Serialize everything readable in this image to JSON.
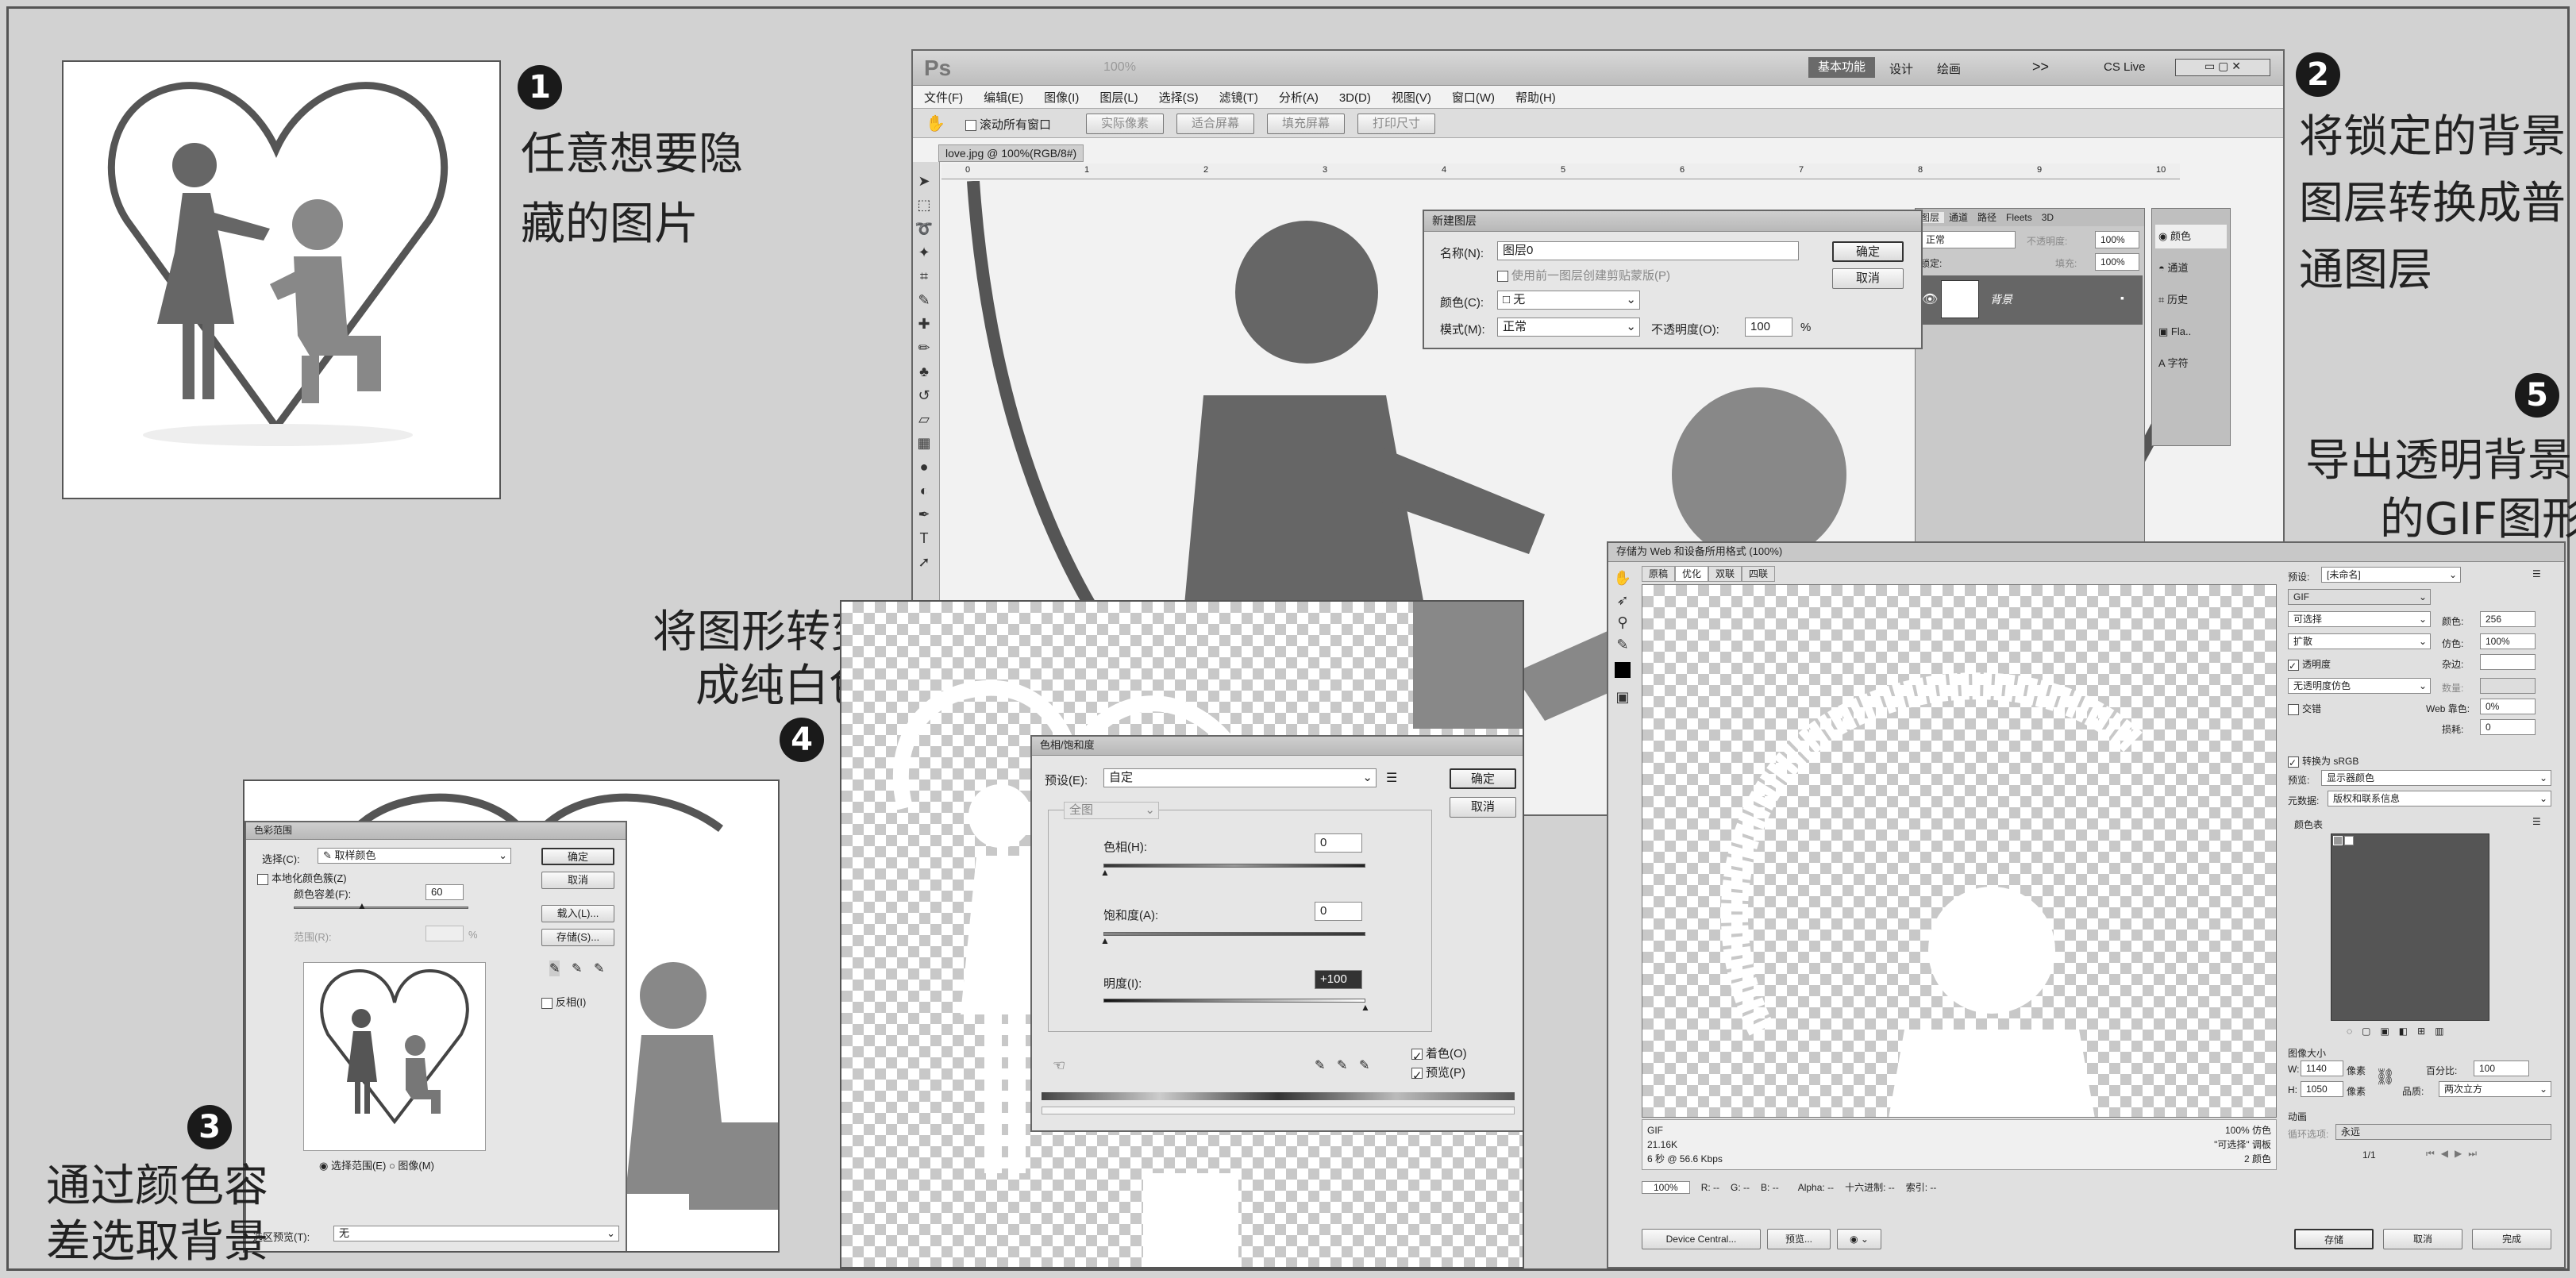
{
  "steps": [
    {
      "num": "1",
      "lines": [
        "任意想要隐",
        "藏的图片"
      ]
    },
    {
      "num": "2",
      "lines": [
        "将锁定的背景",
        "图层转换成普",
        "通图层"
      ]
    },
    {
      "num": "3",
      "lines": [
        "通过颜色容",
        "差选取背景"
      ]
    },
    {
      "num": "4",
      "lines": [
        "将图形转变",
        "成纯白色"
      ]
    },
    {
      "num": "5",
      "lines": [
        "导出透明背景",
        "的GIF图形"
      ]
    }
  ],
  "ps": {
    "logo": "Ps",
    "zoom": "100%",
    "workspace": "基本功能",
    "ws_tabs": [
      "设计",
      "绘画",
      "",
      ">>"
    ],
    "cslive": "CS Live",
    "menu": [
      "文件(F)",
      "编辑(E)",
      "图像(I)",
      "图层(L)",
      "选择(S)",
      "滤镜(T)",
      "分析(A)",
      "3D(D)",
      "视图(V)",
      "窗口(W)",
      "帮助(H)"
    ],
    "options_check": "滚动所有窗口",
    "options_btns": [
      "实际像素",
      "适合屏幕",
      "填充屏幕",
      "打印尺寸"
    ],
    "doc_tab": "love.jpg @ 100%(RGB/8#)",
    "ruler": [
      "0",
      "1",
      "2",
      "3",
      "4",
      "5",
      "6",
      "7",
      "8",
      "9",
      "10"
    ]
  },
  "new_layer": {
    "title": "新建图层",
    "name_label": "名称(N):",
    "name_value": "图层0",
    "clip_label": "使用前一图层创建剪贴蒙版(P)",
    "color_label": "颜色(C):",
    "color_value": "无",
    "mode_label": "模式(M):",
    "mode_value": "正常",
    "opacity_label": "不透明度(O):",
    "opacity_value": "100",
    "pct": "%",
    "ok": "确定",
    "cancel": "取消"
  },
  "layers": {
    "tabs": [
      "图层",
      "通道",
      "路径",
      "Fleets",
      "3D"
    ],
    "mode": "正常",
    "opacity_label": "不透明度:",
    "opacity": "100%",
    "lock_label": "锁定:",
    "fill_label": "填充:",
    "fill": "100%",
    "layer_name": "背景",
    "side": [
      "颜色",
      "通道",
      "历史",
      "Fla..",
      "字符"
    ]
  },
  "color_range": {
    "title": "色彩范围",
    "select_label": "选择(C):",
    "select_value": "取样颜色",
    "localized": "本地化颜色簇(Z)",
    "fuzz_label": "颜色容差(F):",
    "fuzz_value": "60",
    "range_label": "范围(R):",
    "pct": "%",
    "ok": "确定",
    "cancel": "取消",
    "load": "载入(L)...",
    "save": "存储(S)...",
    "invert": "反相(I)",
    "opt_sel": "选择范围(E)",
    "opt_img": "图像(M)",
    "preview_label": "选区预览(T):",
    "preview_value": "无"
  },
  "hue": {
    "title": "色相/饱和度",
    "preset_label": "预设(E):",
    "preset_value": "自定",
    "channel": "全图",
    "hue_label": "色相(H):",
    "hue_value": "0",
    "sat_label": "饱和度(A):",
    "sat_value": "0",
    "light_label": "明度(I):",
    "light_value": "+100",
    "colorize": "着色(O)",
    "preview": "预览(P)",
    "ok": "确定",
    "cancel": "取消"
  },
  "web": {
    "title": "存储为 Web 和设备所用格式 (100%)",
    "tabs": [
      "原稿",
      "优化",
      "双联",
      "四联"
    ],
    "preset_label": "预设:",
    "preset_value": "[未命名]",
    "format": "GIF",
    "reduction": "可选择",
    "colors_label": "颜色:",
    "colors_value": "256",
    "dither_algo": "扩散",
    "dither_label": "仿色:",
    "dither_value": "100%",
    "transparency": "透明度",
    "matte_label": "杂边:",
    "trans_dither": "无透明度仿色",
    "amount_label": "数量:",
    "interlaced": "交错",
    "websnap_label": "Web 靠色:",
    "websnap_value": "0%",
    "lossy_label": "损耗:",
    "lossy_value": "0",
    "convert_srgb": "转换为 sRGB",
    "preview_label": "预览:",
    "preview_value": "显示器颜色",
    "metadata_label": "元数据:",
    "metadata_value": "版权和联系信息",
    "color_table": "颜色表",
    "size_title": "图像大小",
    "w_label": "W:",
    "w_value": "1140",
    "h_label": "H:",
    "h_value": "1050",
    "px": "像素",
    "percent_label": "百分比:",
    "percent_value": "100",
    "quality_label": "品质:",
    "quality_value": "两次立方",
    "anim_title": "动画",
    "loop_label": "循环选项:",
    "loop_value": "永远",
    "frame": "1/1",
    "info_left": [
      "GIF",
      "21.16K",
      "6 秒 @ 56.6 Kbps"
    ],
    "info_right": [
      "100% 仿色",
      "\"可选择\" 调板",
      "2 颜色"
    ],
    "zoom": "100%",
    "status": [
      "R: --",
      "G: --",
      "B: --",
      "Alpha: --",
      "十六进制: --",
      "索引: --"
    ],
    "device_central": "Device Central...",
    "preview_btn": "预览...",
    "save": "存储",
    "cancel": "取消",
    "done": "完成"
  }
}
